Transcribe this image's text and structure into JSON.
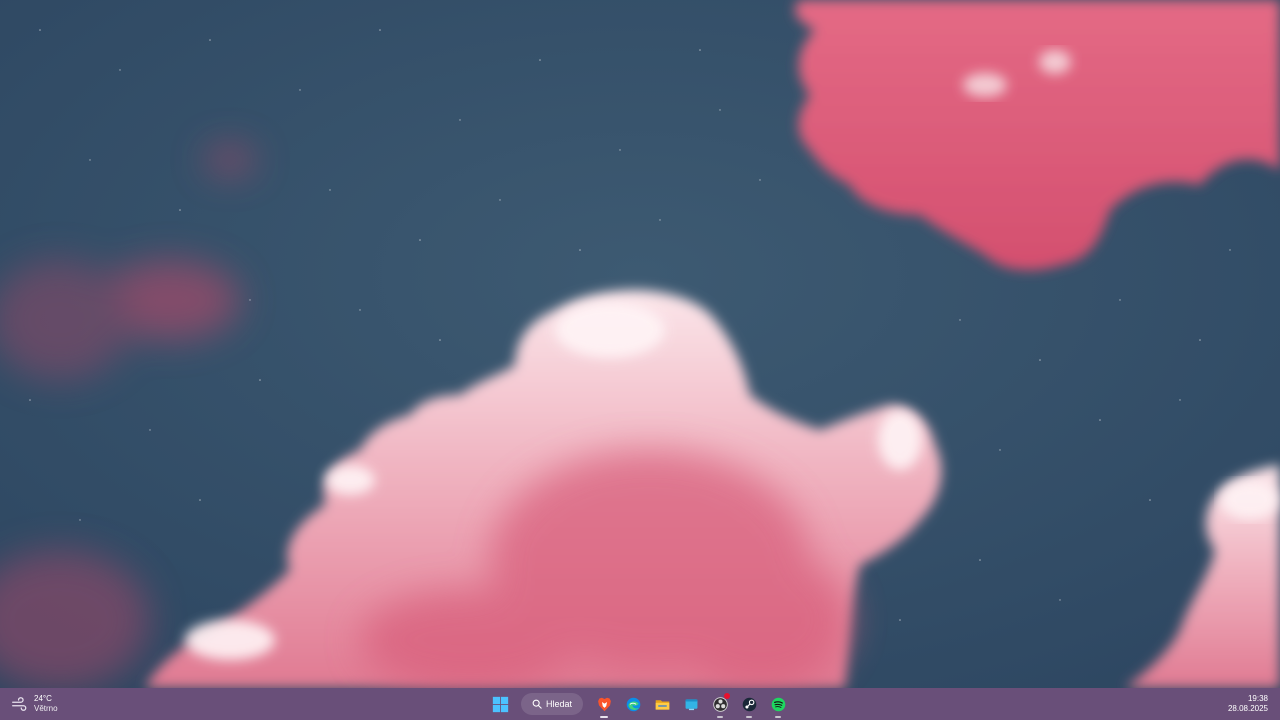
{
  "wallpaper": {
    "sky_color": "#34506a",
    "cloud_colors": [
      "#d85d7a",
      "#f2b3c0",
      "#fce4e8"
    ]
  },
  "taskbar": {
    "background": "#5c406e",
    "weather": {
      "icon": "wind-icon",
      "temperature": "24°C",
      "condition": "Větrno"
    },
    "start_icon": "windows-start-icon",
    "search": {
      "icon": "search-icon",
      "label": "Hledat"
    },
    "pinned_apps": [
      {
        "name": "Brave",
        "icon": "brave-icon",
        "running": true,
        "active": true,
        "badge": false
      },
      {
        "name": "Microsoft Edge",
        "icon": "edge-icon",
        "running": false,
        "badge": false
      },
      {
        "name": "File Explorer",
        "icon": "folder-icon",
        "running": false,
        "badge": false
      },
      {
        "name": "Window",
        "icon": "window-icon",
        "running": false,
        "badge": false
      },
      {
        "name": "OBS Studio",
        "icon": "obs-icon",
        "running": true,
        "badge": true
      },
      {
        "name": "Steam",
        "icon": "steam-icon",
        "running": true,
        "badge": false
      },
      {
        "name": "Spotify",
        "icon": "spotify-icon",
        "running": true,
        "badge": false
      }
    ],
    "clock": {
      "time": "19:38",
      "date": "28.08.2025"
    }
  }
}
